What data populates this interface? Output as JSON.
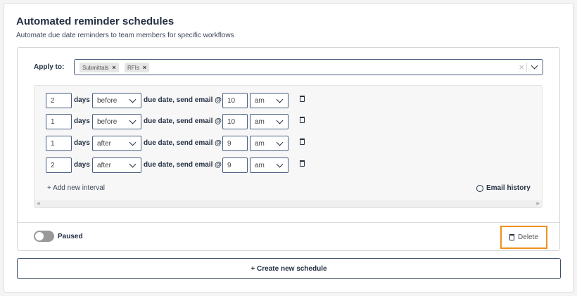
{
  "title": "Automated reminder schedules",
  "subtitle": "Automate due date reminders to team members for specific workflows",
  "apply_to": {
    "label": "Apply to:",
    "chips": [
      "Submittals",
      "RFIs"
    ],
    "clear": "×"
  },
  "intervals": [
    {
      "days": "2",
      "unit": "days",
      "when": "before",
      "text": "due date, send email @",
      "hour": "10",
      "ampm": "am"
    },
    {
      "days": "1",
      "unit": "days",
      "when": "before",
      "text": "due date, send email @",
      "hour": "10",
      "ampm": "am"
    },
    {
      "days": "1",
      "unit": "days",
      "when": "after",
      "text": "due date, send email @",
      "hour": "9",
      "ampm": "am"
    },
    {
      "days": "2",
      "unit": "days",
      "when": "after",
      "text": "due date, send email @",
      "hour": "9",
      "ampm": "am"
    }
  ],
  "add_interval": "+ Add new interval",
  "email_history": "Email history",
  "toggle_label": "Paused",
  "delete_label": "Delete",
  "create_label": "+ Create new schedule",
  "colors": {
    "accent": "#f0901e",
    "border": "#4a6080"
  }
}
